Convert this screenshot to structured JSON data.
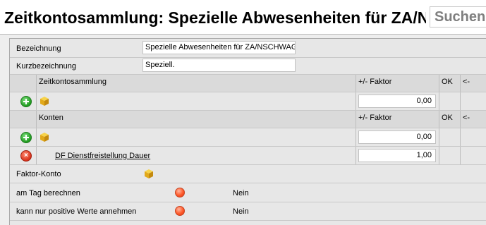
{
  "header": {
    "title": "Zeitkontosammlung: Spezielle Abwesenheiten für ZA/NSCHWAG",
    "search_label": "Suchen"
  },
  "form": {
    "bezeichnung": {
      "label": "Bezeichnung",
      "value": "Spezielle Abwesenheiten für ZA/NSCHWAG"
    },
    "kurzbezeichnung": {
      "label": "Kurzbezeichnung",
      "value": "Speziell."
    }
  },
  "zeitkontosammlung": {
    "header": {
      "col_name": "Zeitkontosammlung",
      "col_faktor": "+/- Faktor",
      "col_ok": "OK",
      "col_arrow": "<-"
    },
    "new_row": {
      "faktor": "0,00"
    }
  },
  "konten": {
    "header": {
      "col_name": "Konten",
      "col_faktor": "+/- Faktor",
      "col_ok": "OK",
      "col_arrow": "<-"
    },
    "new_row": {
      "faktor": "0,00"
    },
    "rows": [
      {
        "name": "DF Dienstfreistellung Dauer",
        "faktor": "1,00"
      }
    ]
  },
  "faktor_konto": {
    "label": "Faktor-Konto",
    "icon": "box-icon"
  },
  "options": [
    {
      "label": "am Tag berechnen",
      "value": "Nein",
      "icon": "red-dot-icon"
    },
    {
      "label": "kann nur positive Werte annehmen",
      "value": "Nein",
      "icon": "red-dot-icon"
    }
  ],
  "colors": {
    "add": "#1f9a1f",
    "delete": "#d8321a",
    "status": "#ff5a2a",
    "box": "#e8b21e"
  }
}
